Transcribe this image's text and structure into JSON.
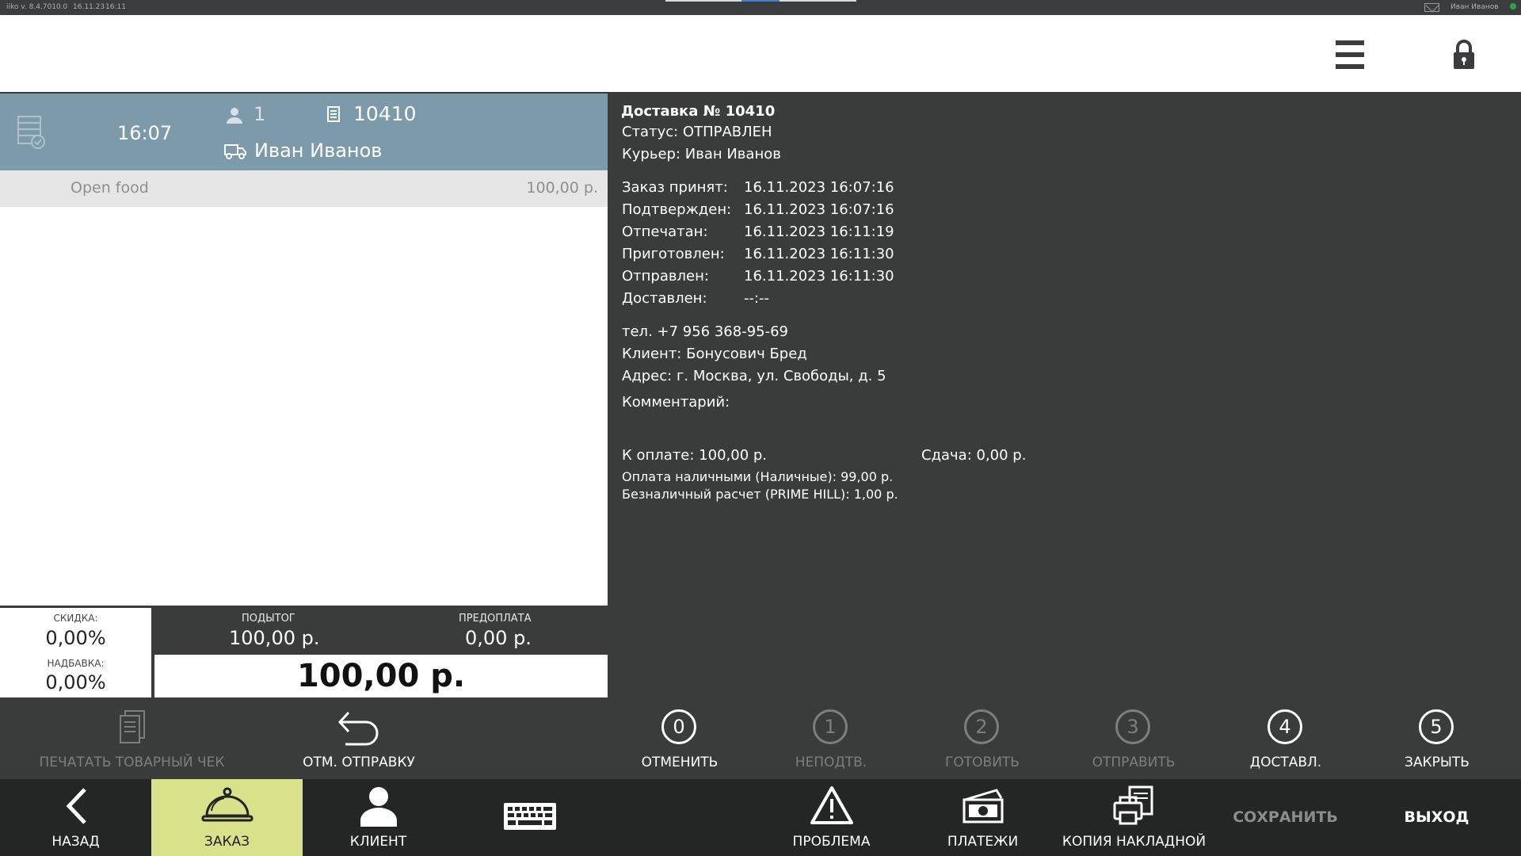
{
  "system_bar": {
    "version": "iiko v. 8.4.7010.0",
    "date": "16.11.23",
    "time": "16:11",
    "user": "Иван Иванов"
  },
  "order_header": {
    "time": "16:07",
    "guests": "1",
    "number": "10410",
    "courier": "Иван Иванов"
  },
  "order_items": [
    {
      "name": "Open food",
      "price": "100,00 р."
    }
  ],
  "totals": {
    "discount_label": "СКИДКА:",
    "discount_value": "0,00%",
    "surcharge_label": "НАДБАВКА:",
    "surcharge_value": "0,00%",
    "subtotal_label": "ПОДЫТОГ",
    "subtotal_value": "100,00 р.",
    "prepay_label": "ПРЕДОПЛАТА",
    "prepay_value": "0,00 р.",
    "grand_total": "100,00 р."
  },
  "delivery": {
    "title": "Доставка № 10410",
    "status": "Статус: ОТПРАВЛЕН",
    "courier": "Курьер: Иван Иванов",
    "timeline": [
      {
        "label": "Заказ принят:",
        "value": "16.11.2023 16:07:16"
      },
      {
        "label": "Подтвержден:",
        "value": "16.11.2023 16:07:16"
      },
      {
        "label": "Отпечатан:",
        "value": "16.11.2023 16:11:19"
      },
      {
        "label": "Приготовлен:",
        "value": "16.11.2023 16:11:30"
      },
      {
        "label": "Отправлен:",
        "value": "16.11.2023 16:11:30"
      },
      {
        "label": "Доставлен:",
        "value": "--:--"
      }
    ],
    "phone": "тел. +7 956 368-95-69",
    "client": "Клиент: Бонусович Бред",
    "address": "Адрес: г. Москва, ул. Свободы, д. 5",
    "comment": "Комментарий:",
    "to_pay": "К оплате:  100,00 р.",
    "change": "Сдача:  0,00 р.",
    "payment_cash": "Оплата наличными (Наличные): 99,00 р.",
    "payment_card": "Безналичный расчет (PRIME HILL): 1,00 р."
  },
  "actions": {
    "print_receipt": "ПЕЧАТАТЬ ТОВАРНЫЙ ЧЕК",
    "cancel_send": "ОТМ. ОТПРАВКУ",
    "steps": [
      {
        "num": "0",
        "label": "ОТМЕНИТЬ",
        "enabled": true
      },
      {
        "num": "1",
        "label": "НЕПОДТВ.",
        "enabled": false
      },
      {
        "num": "2",
        "label": "ГОТОВИТЬ",
        "enabled": false
      },
      {
        "num": "3",
        "label": "ОТПРАВИТЬ",
        "enabled": false
      },
      {
        "num": "4",
        "label": "ДОСТАВЛ.",
        "enabled": true
      },
      {
        "num": "5",
        "label": "ЗАКРЫТЬ",
        "enabled": true
      }
    ]
  },
  "nav": {
    "back": "НАЗАД",
    "order": "ЗАКАЗ",
    "client": "КЛИЕНТ",
    "problem": "ПРОБЛЕМА",
    "payments": "ПЛАТЕЖИ",
    "invoice_copy": "КОПИЯ НАКЛАДНОЙ",
    "save": "СОХРАНИТЬ",
    "exit": "ВЫХОД"
  },
  "colors": {
    "order_header_bg": "#7d9aaa",
    "active_tab_bg": "#d9e28b",
    "panel_bg": "#3a3b3b",
    "nav_bg": "#242525"
  }
}
